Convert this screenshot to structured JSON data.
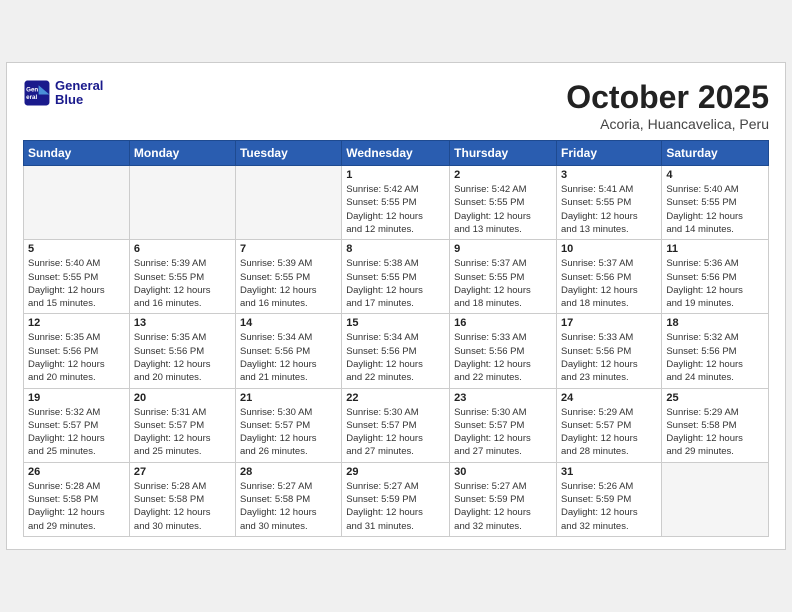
{
  "header": {
    "logo_line1": "General",
    "logo_line2": "Blue",
    "month": "October 2025",
    "location": "Acoria, Huancavelica, Peru"
  },
  "weekdays": [
    "Sunday",
    "Monday",
    "Tuesday",
    "Wednesday",
    "Thursday",
    "Friday",
    "Saturday"
  ],
  "weeks": [
    [
      {
        "day": "",
        "info": ""
      },
      {
        "day": "",
        "info": ""
      },
      {
        "day": "",
        "info": ""
      },
      {
        "day": "1",
        "info": "Sunrise: 5:42 AM\nSunset: 5:55 PM\nDaylight: 12 hours\nand 12 minutes."
      },
      {
        "day": "2",
        "info": "Sunrise: 5:42 AM\nSunset: 5:55 PM\nDaylight: 12 hours\nand 13 minutes."
      },
      {
        "day": "3",
        "info": "Sunrise: 5:41 AM\nSunset: 5:55 PM\nDaylight: 12 hours\nand 13 minutes."
      },
      {
        "day": "4",
        "info": "Sunrise: 5:40 AM\nSunset: 5:55 PM\nDaylight: 12 hours\nand 14 minutes."
      }
    ],
    [
      {
        "day": "5",
        "info": "Sunrise: 5:40 AM\nSunset: 5:55 PM\nDaylight: 12 hours\nand 15 minutes."
      },
      {
        "day": "6",
        "info": "Sunrise: 5:39 AM\nSunset: 5:55 PM\nDaylight: 12 hours\nand 16 minutes."
      },
      {
        "day": "7",
        "info": "Sunrise: 5:39 AM\nSunset: 5:55 PM\nDaylight: 12 hours\nand 16 minutes."
      },
      {
        "day": "8",
        "info": "Sunrise: 5:38 AM\nSunset: 5:55 PM\nDaylight: 12 hours\nand 17 minutes."
      },
      {
        "day": "9",
        "info": "Sunrise: 5:37 AM\nSunset: 5:55 PM\nDaylight: 12 hours\nand 18 minutes."
      },
      {
        "day": "10",
        "info": "Sunrise: 5:37 AM\nSunset: 5:56 PM\nDaylight: 12 hours\nand 18 minutes."
      },
      {
        "day": "11",
        "info": "Sunrise: 5:36 AM\nSunset: 5:56 PM\nDaylight: 12 hours\nand 19 minutes."
      }
    ],
    [
      {
        "day": "12",
        "info": "Sunrise: 5:35 AM\nSunset: 5:56 PM\nDaylight: 12 hours\nand 20 minutes."
      },
      {
        "day": "13",
        "info": "Sunrise: 5:35 AM\nSunset: 5:56 PM\nDaylight: 12 hours\nand 20 minutes."
      },
      {
        "day": "14",
        "info": "Sunrise: 5:34 AM\nSunset: 5:56 PM\nDaylight: 12 hours\nand 21 minutes."
      },
      {
        "day": "15",
        "info": "Sunrise: 5:34 AM\nSunset: 5:56 PM\nDaylight: 12 hours\nand 22 minutes."
      },
      {
        "day": "16",
        "info": "Sunrise: 5:33 AM\nSunset: 5:56 PM\nDaylight: 12 hours\nand 22 minutes."
      },
      {
        "day": "17",
        "info": "Sunrise: 5:33 AM\nSunset: 5:56 PM\nDaylight: 12 hours\nand 23 minutes."
      },
      {
        "day": "18",
        "info": "Sunrise: 5:32 AM\nSunset: 5:56 PM\nDaylight: 12 hours\nand 24 minutes."
      }
    ],
    [
      {
        "day": "19",
        "info": "Sunrise: 5:32 AM\nSunset: 5:57 PM\nDaylight: 12 hours\nand 25 minutes."
      },
      {
        "day": "20",
        "info": "Sunrise: 5:31 AM\nSunset: 5:57 PM\nDaylight: 12 hours\nand 25 minutes."
      },
      {
        "day": "21",
        "info": "Sunrise: 5:30 AM\nSunset: 5:57 PM\nDaylight: 12 hours\nand 26 minutes."
      },
      {
        "day": "22",
        "info": "Sunrise: 5:30 AM\nSunset: 5:57 PM\nDaylight: 12 hours\nand 27 minutes."
      },
      {
        "day": "23",
        "info": "Sunrise: 5:30 AM\nSunset: 5:57 PM\nDaylight: 12 hours\nand 27 minutes."
      },
      {
        "day": "24",
        "info": "Sunrise: 5:29 AM\nSunset: 5:57 PM\nDaylight: 12 hours\nand 28 minutes."
      },
      {
        "day": "25",
        "info": "Sunrise: 5:29 AM\nSunset: 5:58 PM\nDaylight: 12 hours\nand 29 minutes."
      }
    ],
    [
      {
        "day": "26",
        "info": "Sunrise: 5:28 AM\nSunset: 5:58 PM\nDaylight: 12 hours\nand 29 minutes."
      },
      {
        "day": "27",
        "info": "Sunrise: 5:28 AM\nSunset: 5:58 PM\nDaylight: 12 hours\nand 30 minutes."
      },
      {
        "day": "28",
        "info": "Sunrise: 5:27 AM\nSunset: 5:58 PM\nDaylight: 12 hours\nand 30 minutes."
      },
      {
        "day": "29",
        "info": "Sunrise: 5:27 AM\nSunset: 5:59 PM\nDaylight: 12 hours\nand 31 minutes."
      },
      {
        "day": "30",
        "info": "Sunrise: 5:27 AM\nSunset: 5:59 PM\nDaylight: 12 hours\nand 32 minutes."
      },
      {
        "day": "31",
        "info": "Sunrise: 5:26 AM\nSunset: 5:59 PM\nDaylight: 12 hours\nand 32 minutes."
      },
      {
        "day": "",
        "info": ""
      }
    ]
  ]
}
